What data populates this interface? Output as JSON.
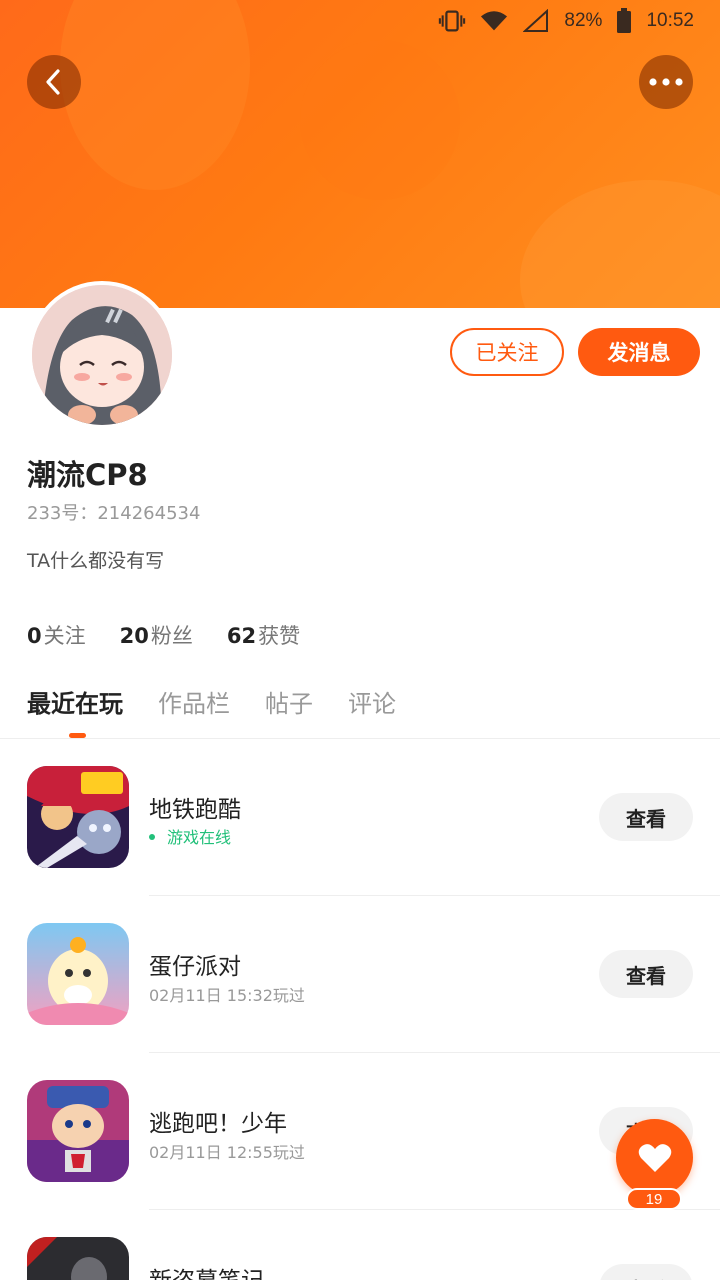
{
  "status_bar": {
    "battery": "82%",
    "time": "10:52"
  },
  "profile": {
    "name": "潮流CP8",
    "id_label": "233号：214264534",
    "bio": "TA什么都没有写",
    "follow_button": "已关注",
    "message_button": "发消息"
  },
  "stats": [
    {
      "value": "0",
      "label": "关注"
    },
    {
      "value": "20",
      "label": "粉丝"
    },
    {
      "value": "62",
      "label": "获赞"
    }
  ],
  "tabs": [
    {
      "label": "最近在玩",
      "active": true
    },
    {
      "label": "作品栏",
      "active": false
    },
    {
      "label": "帖子",
      "active": false
    },
    {
      "label": "评论",
      "active": false
    }
  ],
  "games": [
    {
      "title": "地铁跑酷",
      "subtitle": "游戏在线",
      "online": true,
      "button": "查看"
    },
    {
      "title": "蛋仔派对",
      "subtitle": "02月11日 15:32玩过",
      "online": false,
      "button": "查看"
    },
    {
      "title": "逃跑吧！少年",
      "subtitle": "02月11日 12:55玩过",
      "online": false,
      "button": "查看"
    },
    {
      "title": "新盗墓笔记",
      "subtitle": "",
      "online": false,
      "button": "查看"
    }
  ],
  "like_fab": {
    "count": "19",
    "icon": "heart-icon"
  },
  "colors": {
    "accent": "#ff5a10",
    "online": "#22c07a"
  }
}
